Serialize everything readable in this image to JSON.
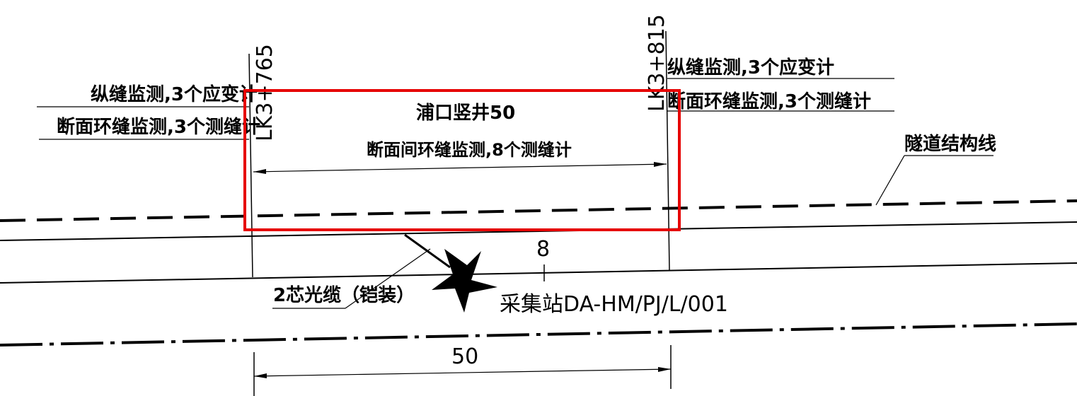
{
  "annotations": {
    "left_note_line1": "纵缝监测,3个应变计",
    "left_note_line2": "断面环缝监测,3个测缝计",
    "right_note_line1": "纵缝监测,3个应变计",
    "right_note_line2": "断面环缝监测,3个测缝计",
    "shaft_label": "浦口竖井50",
    "interval_note": "断面间环缝监测,8个测缝计",
    "tunnel_line_label": "隧道结构线",
    "cable_label": "2芯光缆（铠装）",
    "station_count": "8",
    "station_label": "采集站DA-HM/PJ/L/001",
    "bottom_dimension": "50"
  },
  "chainages": {
    "left": "LK3+765",
    "right": "LK3+815"
  },
  "colors": {
    "line": "#000000",
    "highlight": "#e60000",
    "background": "#ffffff"
  },
  "icons": {
    "station_marker": "star-icon"
  }
}
